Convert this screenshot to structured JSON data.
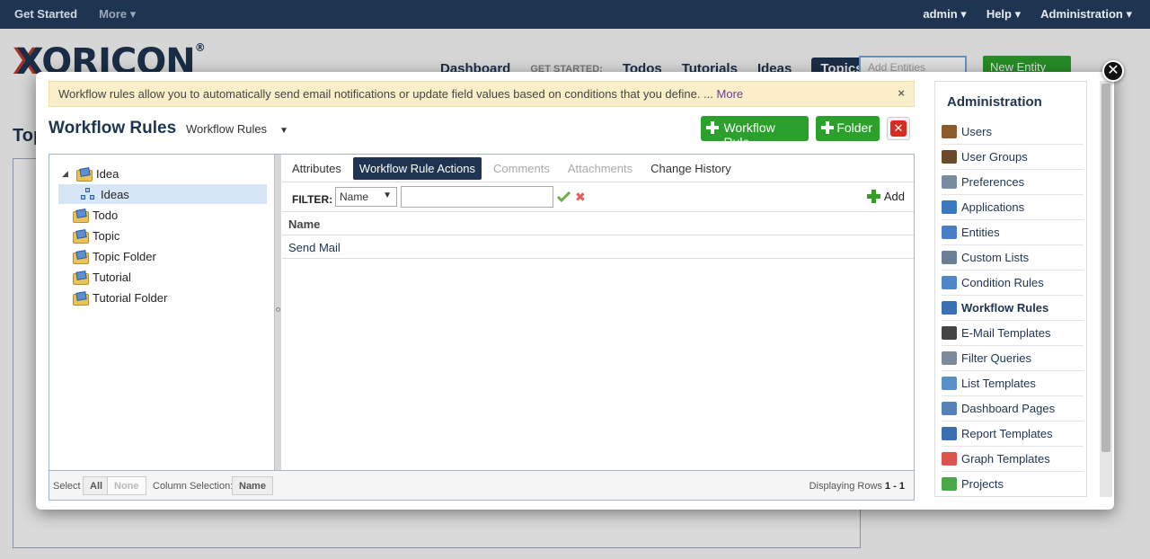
{
  "topbar": {
    "get_started": "Get Started",
    "more": "More ▾",
    "user": "admin ▾",
    "help": "Help ▾",
    "administration": "Administration ▾"
  },
  "background": {
    "logo_text": "XORICON",
    "nav": {
      "dashboard": "Dashboard",
      "get_started_label": "GET STARTED:",
      "todos": "Todos",
      "tutorials": "Tutorials",
      "ideas": "Ideas",
      "topics": "Topics"
    },
    "search_placeholder": "Add Entities",
    "new_entity": "New Entity",
    "page_title_partial": "Top"
  },
  "notice": {
    "text": "Workflow rules allow you to automatically send email notifications or update field values based on conditions that you define. ...",
    "more_link": "More",
    "close": "×"
  },
  "header": {
    "title": "Workflow Rules",
    "selector_value": "Workflow Rules",
    "selector_caret": "▼",
    "btn_workflow_rule": "Workflow Rule",
    "btn_folder": "Folder"
  },
  "tree": [
    {
      "label": "Idea",
      "toggle": "◢"
    },
    {
      "label": "Ideas"
    },
    {
      "label": "Todo"
    },
    {
      "label": "Topic"
    },
    {
      "label": "Topic Folder"
    },
    {
      "label": "Tutorial"
    },
    {
      "label": "Tutorial Folder"
    }
  ],
  "tabs": [
    {
      "label": "Attributes"
    },
    {
      "label": "Workflow Rule Actions"
    },
    {
      "label": "Comments"
    },
    {
      "label": "Attachments"
    },
    {
      "label": "Change History"
    }
  ],
  "filter": {
    "label": "FILTER:",
    "field": "Name",
    "caret": "▼",
    "value": "",
    "add_label": "Add"
  },
  "grid": {
    "column": "Name",
    "rows": [
      "Send Mail"
    ]
  },
  "footer": {
    "select_label": "Select",
    "all": "All",
    "none": "None",
    "column_selection_label": "Column Selection:",
    "column_selection_value": "Name",
    "displaying_label": "Displaying Rows",
    "displaying_range": "1 - 1"
  },
  "admin": {
    "title": "Administration",
    "items": [
      {
        "label": "Users",
        "icon": "user-icon",
        "color": "#8a5a2b"
      },
      {
        "label": "User Groups",
        "icon": "user-groups-icon",
        "color": "#6b4a2b"
      },
      {
        "label": "Preferences",
        "icon": "preferences-icon",
        "color": "#7a8aa0"
      },
      {
        "label": "Applications",
        "icon": "applications-icon",
        "color": "#3c78c0"
      },
      {
        "label": "Entities",
        "icon": "entities-icon",
        "color": "#4a7fc8"
      },
      {
        "label": "Custom Lists",
        "icon": "custom-lists-icon",
        "color": "#6a7f95"
      },
      {
        "label": "Condition Rules",
        "icon": "condition-rules-icon",
        "color": "#4f86c6"
      },
      {
        "label": "Workflow Rules",
        "icon": "workflow-rules-icon",
        "color": "#3b6fb3"
      },
      {
        "label": "E-Mail Templates",
        "icon": "email-icon",
        "color": "#444444"
      },
      {
        "label": "Filter Queries",
        "icon": "filter-queries-icon",
        "color": "#7d8a99"
      },
      {
        "label": "List Templates",
        "icon": "list-templates-icon",
        "color": "#5b8fc8"
      },
      {
        "label": "Dashboard Pages",
        "icon": "dashboard-pages-icon",
        "color": "#5580b8"
      },
      {
        "label": "Report Templates",
        "icon": "report-templates-icon",
        "color": "#3a6fb0"
      },
      {
        "label": "Graph Templates",
        "icon": "graph-templates-icon",
        "color": "#d9534f"
      },
      {
        "label": "Projects",
        "icon": "projects-icon",
        "color": "#4aa84a"
      }
    ]
  },
  "colors": {
    "navy": "#1e3450",
    "green": "#2ca02c",
    "notice_bg": "#faefc8",
    "danger": "#d62d20"
  }
}
